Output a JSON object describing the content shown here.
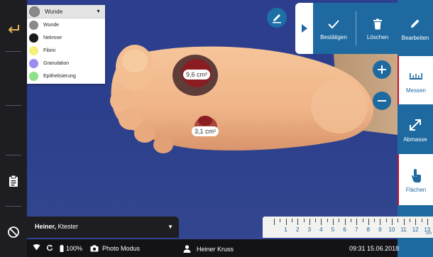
{
  "tissue_dropdown": {
    "selected": "Wunde",
    "items": [
      {
        "label": "Wunde",
        "color": "#8a8a8a"
      },
      {
        "label": "Nekrose",
        "color": "#1a1a1a"
      },
      {
        "label": "Fibrin",
        "color": "#f5f07a"
      },
      {
        "label": "Granulation",
        "color": "#9b8cf0"
      },
      {
        "label": "Epithelisierung",
        "color": "#8de08a"
      }
    ]
  },
  "toolbar": {
    "confirm_label": "Bestätigen",
    "delete_label": "Löschen"
  },
  "sidebar": {
    "edit_label": "Bearbeiten",
    "measure_label": "Messen",
    "dimension_label": "Abmasse",
    "areas_label": "Flächen"
  },
  "wound_areas": [
    {
      "label": "9,6 cm²"
    },
    {
      "label": "3,1 cm²"
    }
  ],
  "ruler": {
    "numbers": [
      "1",
      "2",
      "3",
      "4",
      "5",
      "6",
      "7",
      "8",
      "9",
      "10",
      "11",
      "12",
      "13"
    ],
    "unit": "cm"
  },
  "patient": {
    "last_name": "Heiner",
    "first_name": "Ktester"
  },
  "status": {
    "battery": "100%",
    "mode": "Photo Modus",
    "user": "Heiner Kruss",
    "time": "09:31",
    "date": "15.06.2018"
  },
  "colors": {
    "accent": "#1e6aa0",
    "back_arrow": "#e9b54b",
    "area_badge": "#c8102e"
  }
}
